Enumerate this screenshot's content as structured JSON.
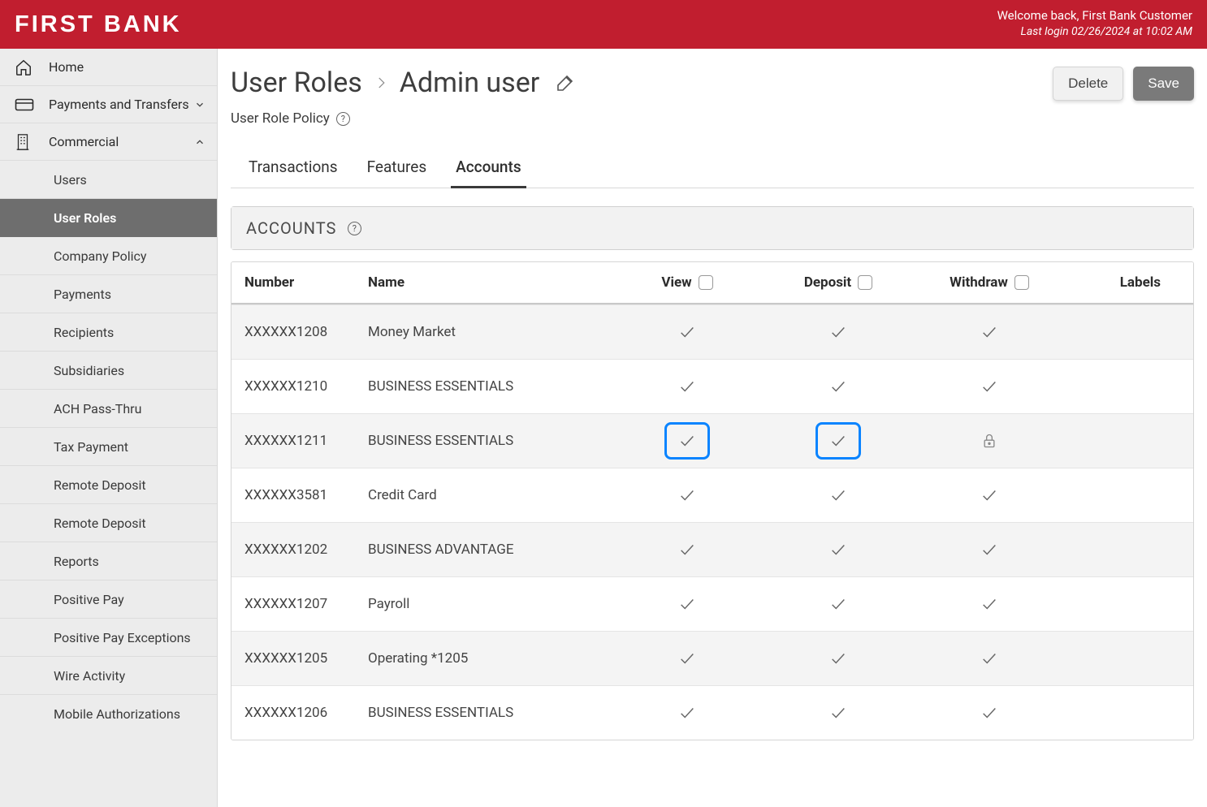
{
  "header": {
    "logo": "FIRST BANK",
    "welcome": "Welcome back, First Bank Customer",
    "last_login": "Last login 02/26/2024 at 10:02 AM"
  },
  "sidebar": {
    "home": "Home",
    "payments": "Payments and Transfers",
    "commercial": "Commercial",
    "sub_users": "Users",
    "sub_user_roles": "User Roles",
    "sub_company_policy": "Company Policy",
    "sub_payments": "Payments",
    "sub_recipients": "Recipients",
    "sub_subsidiaries": "Subsidiaries",
    "sub_ach": "ACH Pass-Thru",
    "sub_tax": "Tax Payment",
    "sub_remote1": "Remote Deposit",
    "sub_remote2": "Remote Deposit",
    "sub_reports": "Reports",
    "sub_positive": "Positive Pay",
    "sub_positive_exc": "Positive Pay Exceptions",
    "sub_wire": "Wire Activity",
    "sub_mobile": "Mobile Authorizations"
  },
  "page": {
    "crumb_root": "User Roles",
    "crumb_leaf": "Admin user",
    "delete": "Delete",
    "save": "Save",
    "policy": "User Role Policy",
    "tab_transactions": "Transactions",
    "tab_features": "Features",
    "tab_accounts": "Accounts",
    "panel_title": "ACCOUNTS"
  },
  "table": {
    "headers": {
      "number": "Number",
      "name": "Name",
      "view": "View",
      "deposit": "Deposit",
      "withdraw": "Withdraw",
      "labels": "Labels"
    },
    "rows": [
      {
        "number": "XXXXXX1208",
        "name": "Money Market",
        "view": "check",
        "deposit": "check",
        "withdraw": "check"
      },
      {
        "number": "XXXXXX1210",
        "name": "BUSINESS ESSENTIALS",
        "view": "check",
        "deposit": "check",
        "withdraw": "check"
      },
      {
        "number": "XXXXXX1211",
        "name": "BUSINESS ESSENTIALS",
        "view": "hl",
        "deposit": "hl",
        "withdraw": "lock"
      },
      {
        "number": "XXXXXX3581",
        "name": "Credit Card",
        "view": "check",
        "deposit": "check",
        "withdraw": "check"
      },
      {
        "number": "XXXXXX1202",
        "name": "BUSINESS ADVANTAGE",
        "view": "check",
        "deposit": "check",
        "withdraw": "check"
      },
      {
        "number": "XXXXXX1207",
        "name": "Payroll",
        "view": "check",
        "deposit": "check",
        "withdraw": "check"
      },
      {
        "number": "XXXXXX1205",
        "name": "Operating *1205",
        "view": "check",
        "deposit": "check",
        "withdraw": "check"
      },
      {
        "number": "XXXXXX1206",
        "name": "BUSINESS ESSENTIALS",
        "view": "check",
        "deposit": "check",
        "withdraw": "check"
      }
    ]
  }
}
